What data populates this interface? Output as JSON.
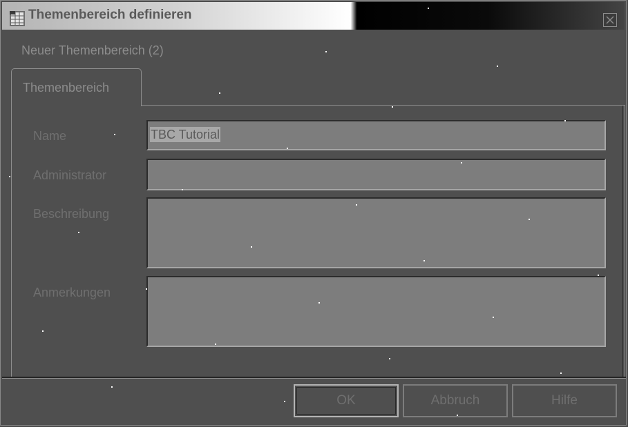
{
  "window": {
    "title": "Themenbereich definieren",
    "icons": {
      "app": "grid-document-icon",
      "close": "close-icon"
    }
  },
  "subtitle": "Neuer Themenbereich (2)",
  "tabs": [
    {
      "label": "Themenbereich",
      "selected": true
    }
  ],
  "form": {
    "name_label": "Name",
    "name_value": "TBC Tutorial",
    "administrator_label": "Administrator",
    "administrator_value": "",
    "beschreibung_label": "Beschreibung",
    "beschreibung_value": "",
    "anmerkungen_label": "Anmerkungen",
    "anmerkungen_value": ""
  },
  "buttons": {
    "ok": "OK",
    "abbruch": "Abbruch",
    "hilfe": "Hilfe"
  },
  "colors": {
    "background": "#4f4f4f",
    "field_background": "#7d7d7d",
    "text_disabled": "#8c8c8c"
  }
}
